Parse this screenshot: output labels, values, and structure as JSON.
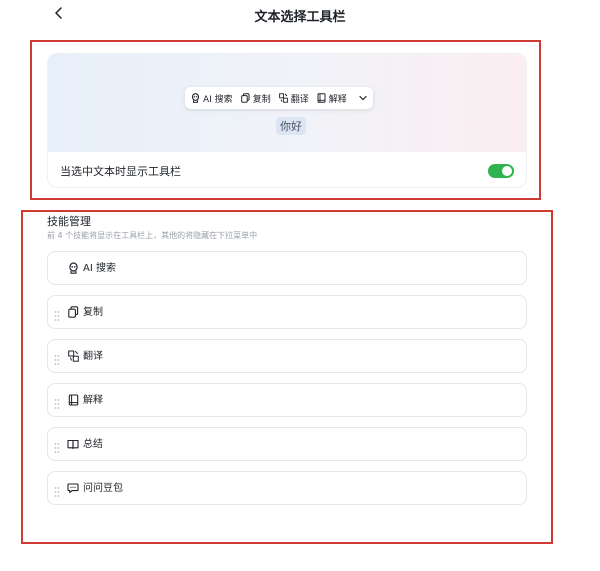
{
  "header": {
    "title": "文本选择工具栏",
    "back_icon": "chevron-left-icon"
  },
  "preview": {
    "toolbar_items": [
      {
        "label": "AI 搜索",
        "icon": "ai-search-icon"
      },
      {
        "label": "复制",
        "icon": "copy-icon"
      },
      {
        "label": "翻译",
        "icon": "translate-icon"
      },
      {
        "label": "解释",
        "icon": "explain-icon"
      }
    ],
    "more_icon": "chevron-down-icon",
    "selected_text": "你好",
    "toggle_label": "当选中文本时显示工具栏",
    "toggle_on": true,
    "toggle_color": "#2fb34f"
  },
  "skills": {
    "title": "技能管理",
    "description": "前 4 个技能将显示在工具栏上，其他的将隐藏在下拉菜单中",
    "items": [
      {
        "label": "AI 搜索",
        "icon": "ai-search-icon",
        "draggable": false
      },
      {
        "label": "复制",
        "icon": "copy-icon",
        "draggable": true
      },
      {
        "label": "翻译",
        "icon": "translate-icon",
        "draggable": true
      },
      {
        "label": "解释",
        "icon": "explain-icon",
        "draggable": true
      },
      {
        "label": "总结",
        "icon": "summary-icon",
        "draggable": true
      },
      {
        "label": "问问豆包",
        "icon": "chat-icon",
        "draggable": true
      }
    ]
  },
  "highlight_color": "#cf3b30"
}
